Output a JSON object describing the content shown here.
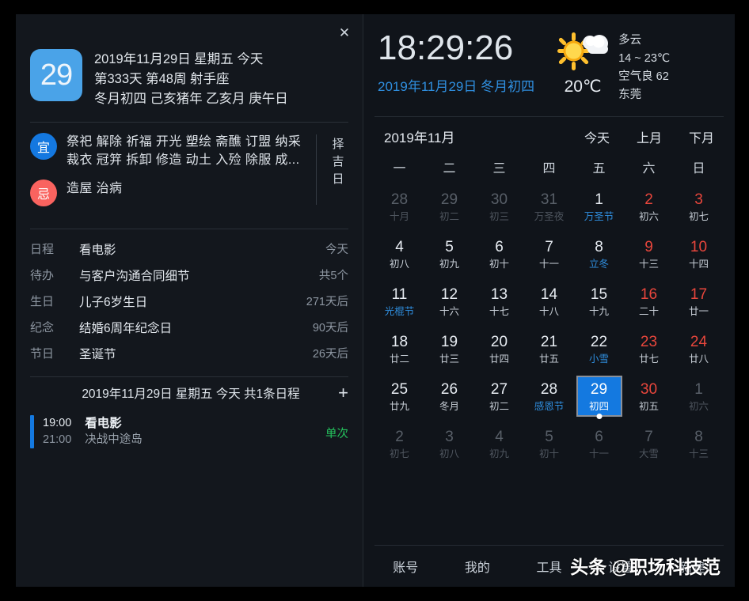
{
  "window": {
    "close_icon": "close-icon"
  },
  "left": {
    "day_badge": "29",
    "day_lines": [
      "2019年11月29日 星期五 今天",
      "第333天 第48周 射手座",
      "冬月初四 己亥猪年 乙亥月 庚午日"
    ],
    "almanac": {
      "yi_label": "宜",
      "yi_text": "祭祀 解除 祈福 开光 塑绘 斋醮 订盟 纳采 裁衣 冠笄 拆卸 修造 动土 入殓 除服 成...",
      "ji_label": "忌",
      "ji_text": "造屋 治病",
      "vertical_label": "择吉日",
      "yi_color": "#1478e0",
      "ji_color": "#f9635f"
    },
    "list": [
      {
        "category": "日程",
        "title": "看电影",
        "meta": "今天"
      },
      {
        "category": "待办",
        "title": "与客户沟通合同细节",
        "meta": "共5个"
      },
      {
        "category": "生日",
        "title": "儿子6岁生日",
        "meta": "271天后"
      },
      {
        "category": "纪念",
        "title": "结婚6周年纪念日",
        "meta": "90天后"
      },
      {
        "category": "节日",
        "title": "圣诞节",
        "meta": "26天后"
      }
    ],
    "event_section": {
      "header": "2019年11月29日 星期五 今天 共1条日程",
      "add_icon": "+",
      "event": {
        "start_time": "19:00",
        "end_time": "21:00",
        "title": "看电影",
        "subtitle": "决战中途岛",
        "repeat": "单次",
        "repeat_color": "#25c45e",
        "bar_color": "#1479e0"
      }
    }
  },
  "right": {
    "clock": "18:29:26",
    "clock_date": "2019年11月29日 冬月初四",
    "weather": {
      "icon": "sun-cloud-icon",
      "current_temp": "20℃",
      "condition": "多云",
      "range": "14 ~ 23℃",
      "air": "空气良 62",
      "city": "东莞"
    },
    "calendar": {
      "month_label": "2019年11月",
      "buttons": [
        "今天",
        "上月",
        "下月"
      ],
      "weekdays": [
        "一",
        "二",
        "三",
        "四",
        "五",
        "六",
        "日"
      ],
      "selected": "29",
      "weeks": [
        [
          {
            "d": "28",
            "l": "十月",
            "out": true
          },
          {
            "d": "29",
            "l": "初二",
            "out": true
          },
          {
            "d": "30",
            "l": "初三",
            "out": true
          },
          {
            "d": "31",
            "l": "万圣夜",
            "out": true
          },
          {
            "d": "1",
            "l": "万圣节",
            "fest": true
          },
          {
            "d": "2",
            "l": "初六",
            "weekend": true
          },
          {
            "d": "3",
            "l": "初七",
            "weekend": true
          }
        ],
        [
          {
            "d": "4",
            "l": "初八"
          },
          {
            "d": "5",
            "l": "初九"
          },
          {
            "d": "6",
            "l": "初十"
          },
          {
            "d": "7",
            "l": "十一"
          },
          {
            "d": "8",
            "l": "立冬",
            "fest": true
          },
          {
            "d": "9",
            "l": "十三",
            "weekend": true
          },
          {
            "d": "10",
            "l": "十四",
            "weekend": true
          }
        ],
        [
          {
            "d": "11",
            "l": "光棍节",
            "fest": true
          },
          {
            "d": "12",
            "l": "十六"
          },
          {
            "d": "13",
            "l": "十七"
          },
          {
            "d": "14",
            "l": "十八"
          },
          {
            "d": "15",
            "l": "十九"
          },
          {
            "d": "16",
            "l": "二十",
            "weekend": true
          },
          {
            "d": "17",
            "l": "廿一",
            "weekend": true
          }
        ],
        [
          {
            "d": "18",
            "l": "廿二"
          },
          {
            "d": "19",
            "l": "廿三"
          },
          {
            "d": "20",
            "l": "廿四"
          },
          {
            "d": "21",
            "l": "廿五"
          },
          {
            "d": "22",
            "l": "小雪",
            "fest": true
          },
          {
            "d": "23",
            "l": "廿七",
            "weekend": true
          },
          {
            "d": "24",
            "l": "廿八",
            "weekend": true
          }
        ],
        [
          {
            "d": "25",
            "l": "廿九"
          },
          {
            "d": "26",
            "l": "冬月"
          },
          {
            "d": "27",
            "l": "初二"
          },
          {
            "d": "28",
            "l": "感恩节",
            "fest": true
          },
          {
            "d": "29",
            "l": "初四",
            "selected": true,
            "dot": true
          },
          {
            "d": "30",
            "l": "初五",
            "weekend": true
          },
          {
            "d": "1",
            "l": "初六",
            "out": true
          }
        ],
        [
          {
            "d": "2",
            "l": "初七",
            "out": true
          },
          {
            "d": "3",
            "l": "初八",
            "out": true
          },
          {
            "d": "4",
            "l": "初九",
            "out": true
          },
          {
            "d": "5",
            "l": "初十",
            "out": true
          },
          {
            "d": "6",
            "l": "十一",
            "out": true
          },
          {
            "d": "7",
            "l": "大雪",
            "out": true
          },
          {
            "d": "8",
            "l": "十三",
            "out": true
          }
        ]
      ]
    },
    "navbar": [
      "账号",
      "我的",
      "工具",
      "设置",
      "新建"
    ],
    "watermark": "头条 @职场科技范"
  }
}
